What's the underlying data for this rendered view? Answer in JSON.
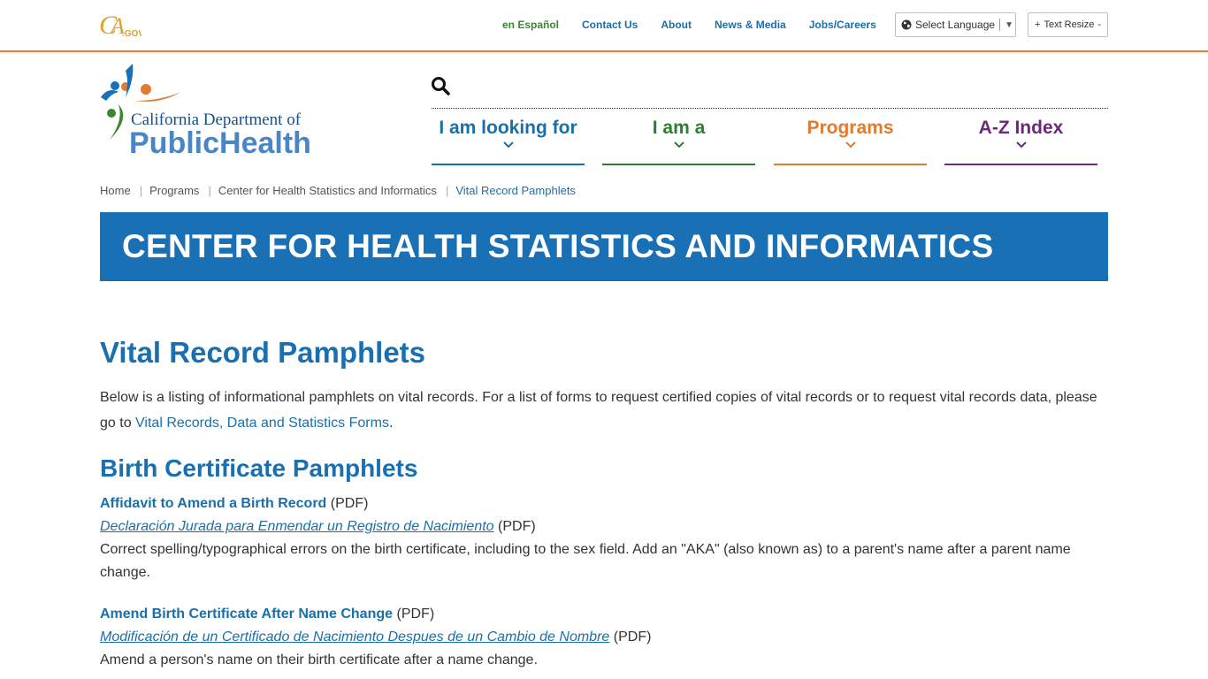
{
  "utility_nav": {
    "logo_text": "CA.GOV",
    "links": [
      "en Español",
      "Contact Us",
      "About",
      "News & Media",
      "Jobs/Careers"
    ],
    "language_select": "Select Language",
    "text_resize": "Text Resize"
  },
  "brand": {
    "line1": "California Department of",
    "line2": "PublicHealth"
  },
  "main_nav": {
    "items": [
      "I am looking for",
      "I am a",
      "Programs",
      "A-Z Index"
    ]
  },
  "breadcrumb": [
    "Home",
    "Programs",
    "Center for Health Statistics and Informatics",
    "Vital Record Pamphlets"
  ],
  "banner": {
    "title": "CENTER FOR HEALTH STATISTICS AND INFORMATICS"
  },
  "content": {
    "title": "Vital Record Pamphlets",
    "intro_text": "Below is a listing of informational pamphlets on vital records. For a list of forms to request certified copies of vital records or to request vital records data, please go to ",
    "intro_link": "Vital Records, Data and Statistics Forms",
    "intro_end": ".",
    "section_title": "Birth Certificate Pamphlets",
    "items": [
      {
        "title_en": "Affidavit to Amend a Birth Record",
        "pdf": "(PDF)",
        "title_es": "Declaración Jurada para Enmendar un Registro de Nacimiento",
        "pdf_es": "(PDF)",
        "description": "Correct spelling/typographical errors on the birth certificate, including to the sex field. Add an \"AKA\" (also known as) to a parent's name after a parent name change."
      },
      {
        "title_en": "Amend Birth Certificate After Name Change",
        "pdf": "(PDF)",
        "title_es": "Modificación de un Certificado de Nacimiento Despues de un Cambio de Nombre",
        "pdf_es": "(PDF)",
        "description": "Amend a person's name on their birth certificate after a name change."
      }
    ]
  },
  "colors": {
    "orange_rule": "#e8832b",
    "banner_blue": "#1a70b5",
    "link_blue": "#1b6fa9",
    "nav_green": "#2f7d32",
    "nav_orange": "#e07b30",
    "nav_purple": "#6b2a78"
  },
  "icons": [
    "globe-icon",
    "search-icon",
    "chevron-down-icon"
  ]
}
